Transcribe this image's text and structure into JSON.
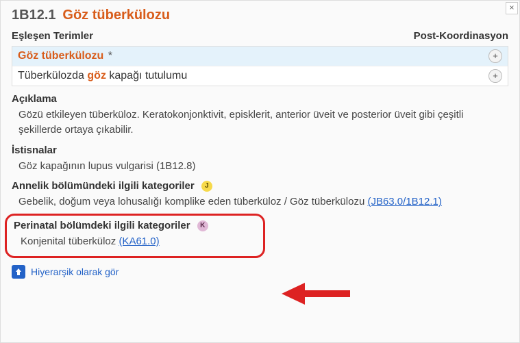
{
  "close": "×",
  "header": {
    "code": "1B12.1",
    "title": "Göz tüberkülozu"
  },
  "subheader": {
    "left": "Eşleşen Terimler",
    "right": "Post-Koordinasyon"
  },
  "terms": [
    {
      "pre": "",
      "hl": "Göz tüberkülozu",
      "post": "",
      "star": "*"
    },
    {
      "pre": "Tüberkülozda ",
      "hl": "göz",
      "post": " kapağı tutulumu",
      "star": ""
    }
  ],
  "plus": "+",
  "desc": {
    "title": "Açıklama",
    "body": "Gözü etkileyen tüberküloz. Keratokonjonktivit, episklerit, anterior üveit ve posterior üveit gibi çeşitli şekillerde ortaya çıkabilir."
  },
  "excl": {
    "title": "İstisnalar",
    "body": "Göz kapağının lupus vulgarisi (1B12.8)"
  },
  "maternal": {
    "title": "Annelik bölümündeki ilgili kategoriler",
    "badge": "J",
    "body_pre": "Gebelik, doğum veya lohusalığı komplike eden tüberküloz / Göz tüberkülozu  ",
    "link": "(JB63.0/1B12.1)"
  },
  "perinatal": {
    "title": "Perinatal bölümdeki ilgili kategoriler",
    "badge": "K",
    "body_pre": "Konjenital tüberküloz  ",
    "link": "(KA61.0)"
  },
  "footer": {
    "label": "Hiyerarşik olarak gör"
  }
}
